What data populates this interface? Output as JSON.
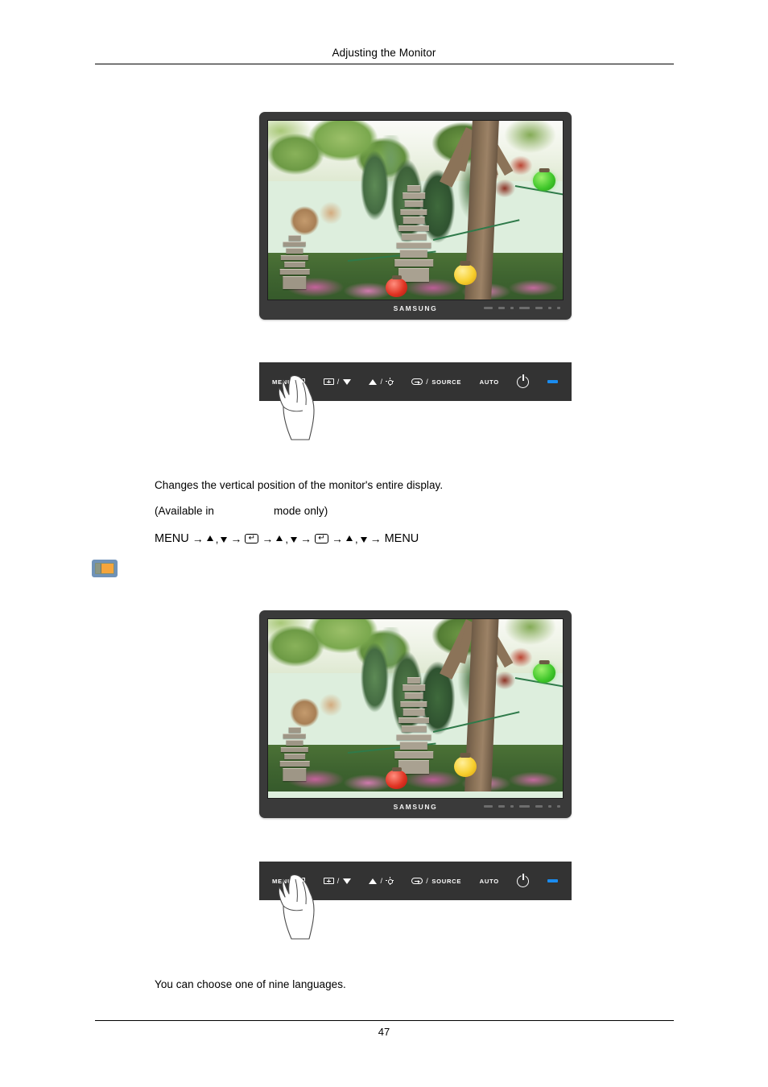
{
  "document": {
    "header_title": "Adjusting the Monitor",
    "page_number": "47"
  },
  "sections": [
    {
      "description": "Changes the vertical position of the monitor's entire display.",
      "availability_prefix": "(Available in",
      "availability_suffix": "mode only)",
      "menu_path_start": "MENU",
      "menu_path_end": "MENU"
    },
    {
      "description": "You can choose one of nine languages."
    }
  ],
  "monitor": {
    "brand": "SAMSUNG",
    "photo_alt": "Garden scene with stone pagoda, trees and paper lanterns"
  },
  "control_panel": {
    "buttons": [
      {
        "label": "MENU",
        "icon": "menu-grid-icon"
      },
      {
        "label": "",
        "icon": "box-plus-icon",
        "separator": "/",
        "icon2": "triangle-down-icon"
      },
      {
        "label": "",
        "icon": "triangle-up-icon",
        "separator": "/",
        "icon2": "brightness-icon"
      },
      {
        "label": "SOURCE",
        "icon": "box-arrow-icon",
        "separator": "/"
      },
      {
        "label": "AUTO",
        "icon": ""
      },
      {
        "label": "",
        "icon": "power-icon"
      },
      {
        "label": "",
        "icon": "led-indicator"
      }
    ],
    "led_color": "#1a8cf0",
    "panel_color": "#333333"
  },
  "icons": {
    "display_icon_name": "display-mode-icon",
    "display_icon_bg": "#6f92b8",
    "display_icon_fill": "#f5a53c",
    "enter_glyph": "↵",
    "arrow_glyph": "→",
    "comma_glyph": ","
  }
}
